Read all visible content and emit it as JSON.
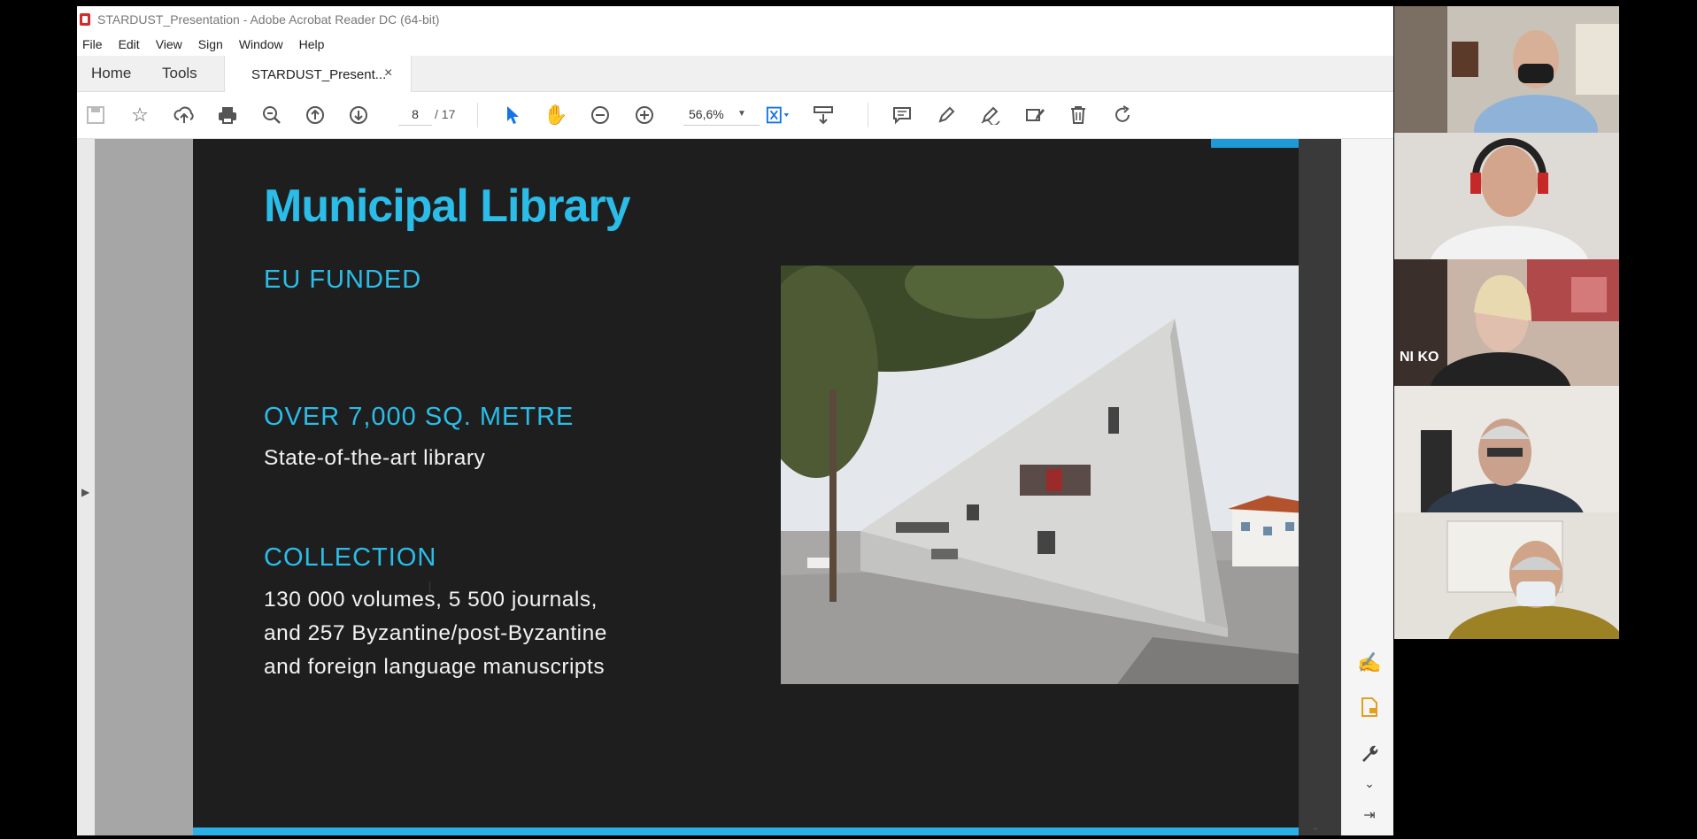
{
  "window": {
    "title": "STARDUST_Presentation - Adobe Acrobat Reader DC (64-bit)"
  },
  "menu": [
    "File",
    "Edit",
    "View",
    "Sign",
    "Window",
    "Help"
  ],
  "tabs": {
    "home": "Home",
    "tools": "Tools",
    "document": "STARDUST_Present...",
    "close": "×"
  },
  "toolbar": {
    "page_current": "8",
    "page_total": "/ 17",
    "zoom": "56,6%",
    "icons": [
      "save-icon",
      "star-icon",
      "upload-icon",
      "print-icon",
      "zoom-search-icon",
      "page-up-icon",
      "page-down-icon",
      "select-arrow-icon",
      "hand-icon",
      "zoom-out-icon",
      "zoom-in-icon",
      "fit-page-icon",
      "scroll-mode-icon",
      "comment-icon",
      "highlight-icon",
      "sign-icon",
      "redact-icon",
      "delete-icon",
      "rotate-icon"
    ]
  },
  "slide": {
    "title": "Municipal Library",
    "section1_heading": "EU FUNDED",
    "section2_heading": "OVER 7,000 SQ. METRE",
    "section2_text": "State-of-the-art library",
    "section3_heading": "COLLECTION",
    "section3_lines": [
      "130 000 volumes, 5 500 journals,",
      "and 257 Byzantine/post-Byzantine",
      "and foreign language manuscripts"
    ],
    "photo": "library-building-photo"
  },
  "colors": {
    "accent": "#2bbde8",
    "slide_bg": "#1e1e1f",
    "acrobat_blue": "#1473e6"
  },
  "participants": [
    "participant-1",
    "participant-2",
    "participant-3",
    "participant-4",
    "participant-5"
  ]
}
